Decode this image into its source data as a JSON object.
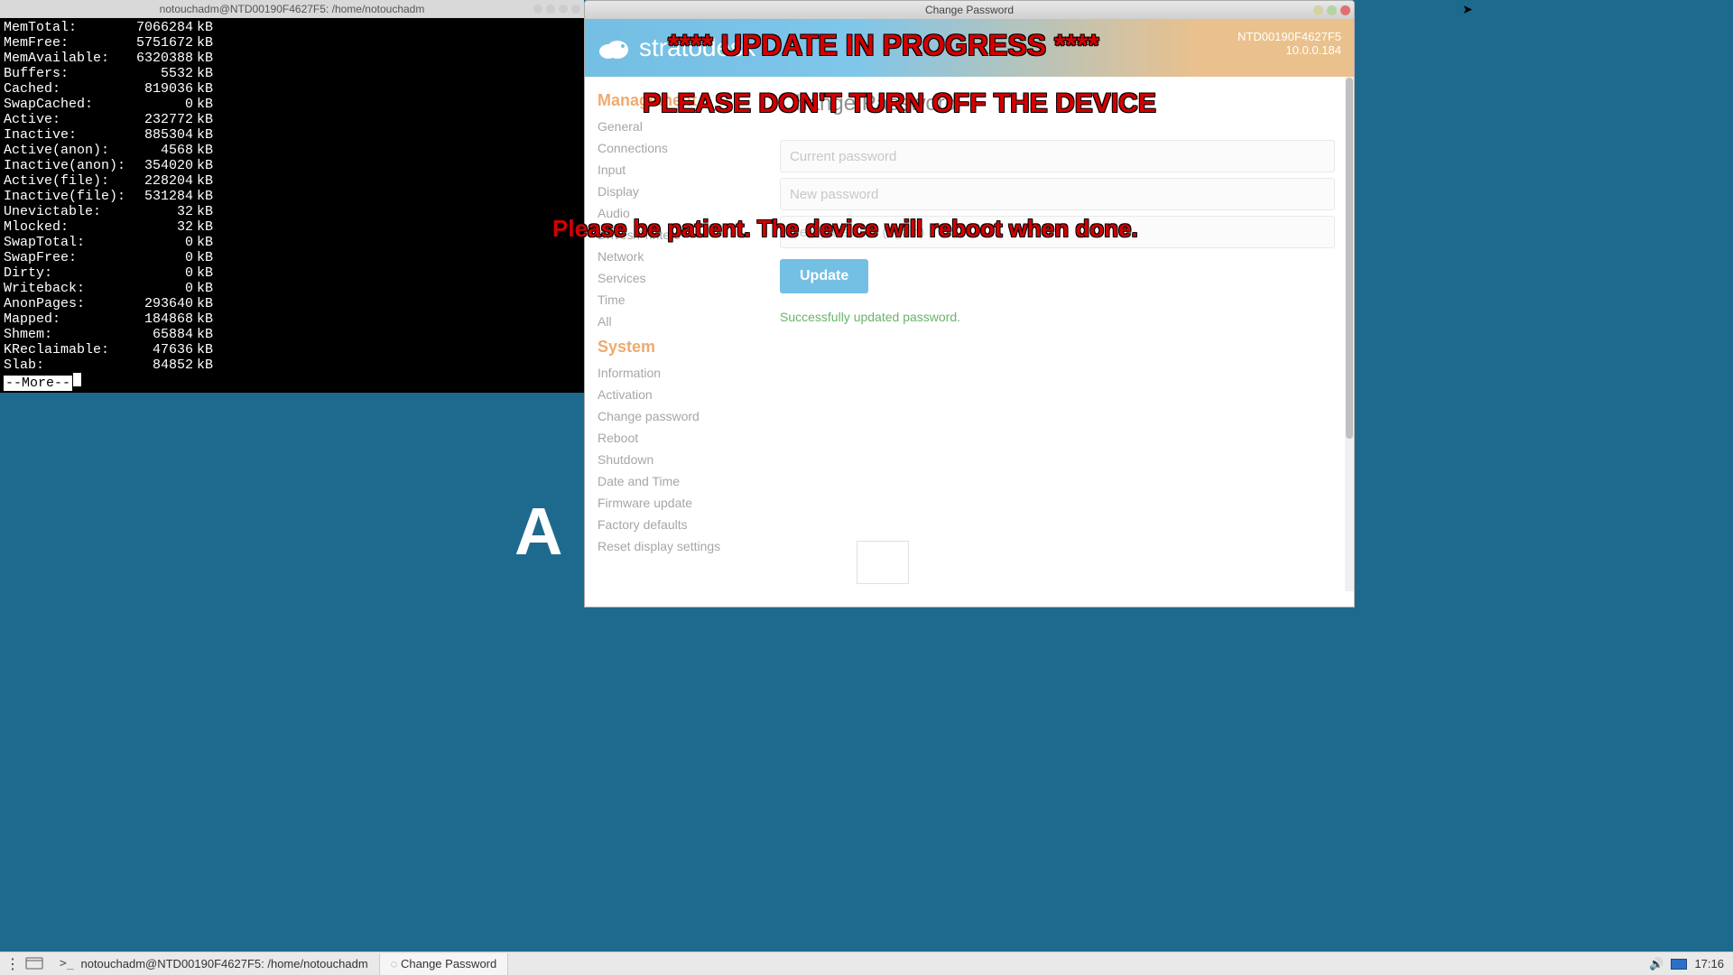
{
  "terminal": {
    "title": "notouchadm@NTD00190F4627F5: /home/notouchadm",
    "unit": "kB",
    "rows": [
      {
        "key": "MemTotal:",
        "val": "7066284"
      },
      {
        "key": "MemFree:",
        "val": "5751672"
      },
      {
        "key": "MemAvailable:",
        "val": "6320388"
      },
      {
        "key": "Buffers:",
        "val": "5532"
      },
      {
        "key": "Cached:",
        "val": "819036"
      },
      {
        "key": "SwapCached:",
        "val": "0"
      },
      {
        "key": "Active:",
        "val": "232772"
      },
      {
        "key": "Inactive:",
        "val": "885304"
      },
      {
        "key": "Active(anon):",
        "val": "4568"
      },
      {
        "key": "Inactive(anon):",
        "val": "354020"
      },
      {
        "key": "Active(file):",
        "val": "228204"
      },
      {
        "key": "Inactive(file):",
        "val": "531284"
      },
      {
        "key": "Unevictable:",
        "val": "32"
      },
      {
        "key": "Mlocked:",
        "val": "32"
      },
      {
        "key": "SwapTotal:",
        "val": "0"
      },
      {
        "key": "SwapFree:",
        "val": "0"
      },
      {
        "key": "Dirty:",
        "val": "0"
      },
      {
        "key": "Writeback:",
        "val": "0"
      },
      {
        "key": "AnonPages:",
        "val": "293640"
      },
      {
        "key": "Mapped:",
        "val": "184868"
      },
      {
        "key": "Shmem:",
        "val": "65884"
      },
      {
        "key": "KReclaimable:",
        "val": "47636"
      },
      {
        "key": "Slab:",
        "val": "84852"
      }
    ],
    "more": "--More--"
  },
  "browser": {
    "title": "Change Password",
    "header": {
      "logo": "stratodesk",
      "hostname": "NTD00190F4627F5",
      "ip": "10.0.0.184"
    },
    "sidebar": {
      "section1": "Management",
      "items1": [
        "General",
        "Connections",
        "Input",
        "Display",
        "Audio",
        "Drives/Printers",
        "Network",
        "Services",
        "Time",
        "All"
      ],
      "section2": "System",
      "items2": [
        "Information",
        "Activation",
        "Change password",
        "Reboot",
        "Shutdown",
        "Date and Time",
        "Firmware update",
        "Factory defaults",
        "Reset display settings"
      ]
    },
    "main": {
      "title": "Change Password",
      "ph_current": "Current password",
      "ph_new": "New password",
      "ph_again": "New password (again)",
      "update": "Update",
      "success": "Successfully updated password."
    }
  },
  "overlay": {
    "l1": "**** UPDATE IN PROGRESS ****",
    "l2": "PLEASE DON'T TURN OFF THE DEVICE",
    "l3": "Please be patient. The device will reboot when done."
  },
  "desktop_icon": "A",
  "taskbar": {
    "terminal": "notouchadm@NTD00190F4627F5: /home/notouchadm",
    "browser": "Change Password",
    "clock": "17:16"
  }
}
